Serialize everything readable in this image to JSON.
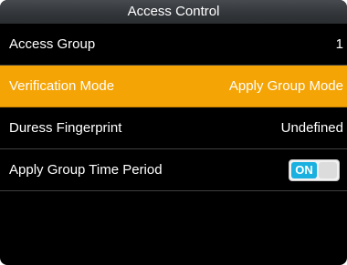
{
  "header": {
    "title": "Access Control"
  },
  "menu": {
    "items": [
      {
        "label": "Access Group",
        "value": "1"
      },
      {
        "label": "Verification Mode",
        "value": "Apply Group Mode"
      },
      {
        "label": "Duress Fingerprint",
        "value": "Undefined"
      },
      {
        "label": "Apply Group Time Period",
        "toggle_label": "ON",
        "toggle_state": "on"
      }
    ],
    "selected_index": 1
  },
  "colors": {
    "selection": "#f5a405",
    "toggle_on": "#1ab0e0",
    "background": "#000000"
  }
}
